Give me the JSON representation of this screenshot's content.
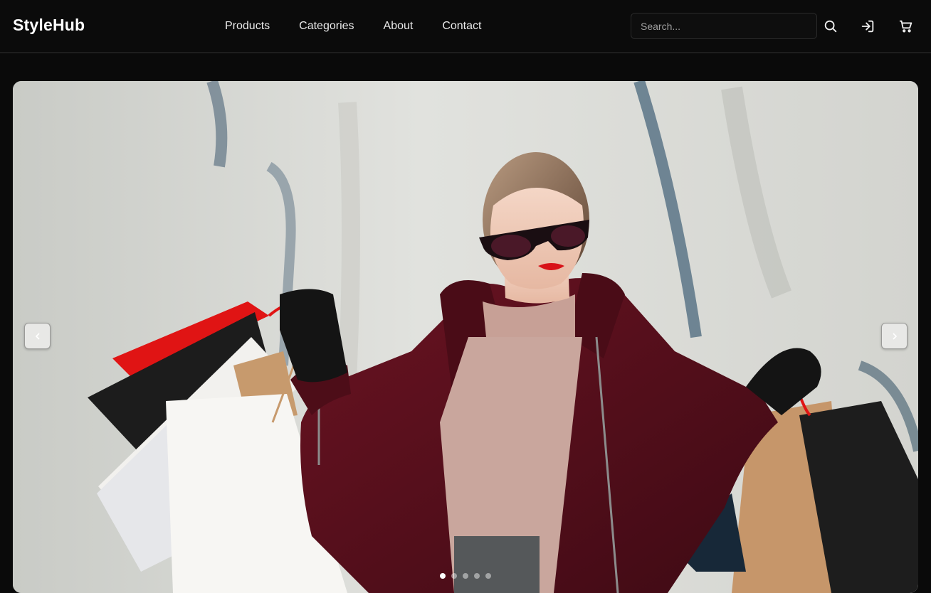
{
  "header": {
    "brand": "StyleHub",
    "nav": [
      {
        "label": "Products"
      },
      {
        "label": "Categories"
      },
      {
        "label": "About"
      },
      {
        "label": "Contact"
      }
    ],
    "search": {
      "placeholder": "Search..."
    },
    "icons": [
      "search-icon",
      "sign-in-icon",
      "cart-icon"
    ]
  },
  "hero": {
    "image": "woman-with-shopping-bags",
    "slide_count": 5,
    "active_slide": 1,
    "prev_icon": "chevron-left-icon",
    "next_icon": "chevron-right-icon"
  },
  "colors": {
    "background": "#0a0a0a",
    "header": "#0b0b0b",
    "text": "#ffffff",
    "coat": "#5a0f1c",
    "accent_red": "#e01414"
  }
}
